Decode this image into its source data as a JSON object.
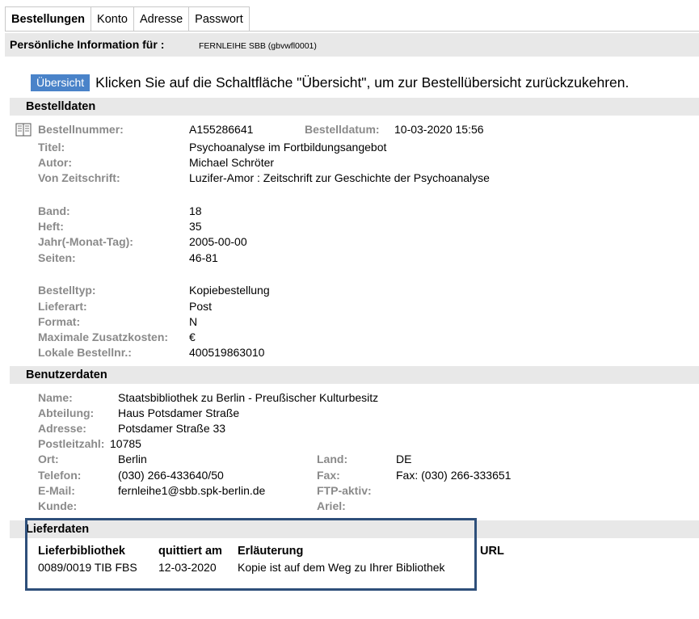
{
  "tabs": [
    "Bestellungen",
    "Konto",
    "Adresse",
    "Passwort"
  ],
  "info": {
    "label": "Persönliche Information für :",
    "value": "FERNLEIHE SBB (gbvwfl0001)"
  },
  "overview": {
    "button": "Übersicht",
    "text": "Klicken Sie auf die Schaltfläche \"Übersicht\", um zur Bestellübersicht zurückzukehren."
  },
  "bestelldaten": {
    "title": "Bestelldaten",
    "bestellnummer_label": "Bestellnummer:",
    "bestellnummer": "A155286641",
    "bestelldatum_label": "Bestelldatum:",
    "bestelldatum": "10-03-2020 15:56",
    "titel_label": "Titel:",
    "titel": "Psychoanalyse im Fortbildungsangebot",
    "autor_label": "Autor:",
    "autor": "Michael Schröter",
    "zeitschrift_label": "Von Zeitschrift:",
    "zeitschrift": "Luzifer-Amor : Zeitschrift zur Geschichte der Psychoanalyse",
    "band_label": "Band:",
    "band": "18",
    "heft_label": "Heft:",
    "heft": "35",
    "jahr_label": "Jahr(-Monat-Tag):",
    "jahr": "2005-00-00",
    "seiten_label": "Seiten:",
    "seiten": "46-81",
    "bestelltyp_label": "Bestelltyp:",
    "bestelltyp": "Kopiebestellung",
    "lieferart_label": "Lieferart:",
    "lieferart": "Post",
    "format_label": "Format:",
    "format": "N",
    "kosten_label": "Maximale Zusatzkosten:",
    "kosten": "€",
    "lokale_label": "Lokale Bestellnr.:",
    "lokale": "400519863010"
  },
  "benutzerdaten": {
    "title": "Benutzerdaten",
    "name_label": "Name:",
    "name": "Staatsbibliothek zu Berlin - Preußischer Kulturbesitz",
    "abteilung_label": "Abteilung:",
    "abteilung": "Haus Potsdamer Straße",
    "adresse_label": "Adresse:",
    "adresse": "Potsdamer Straße 33",
    "plz_label": "Postleitzahl:",
    "plz": "10785",
    "ort_label": "Ort:",
    "ort": "Berlin",
    "land_label": "Land:",
    "land": "DE",
    "telefon_label": "Telefon:",
    "telefon": "(030) 266-433640/50",
    "fax_label": "Fax:",
    "fax": "Fax: (030) 266-333651",
    "email_label": "E-Mail:",
    "email": "fernleihe1@sbb.spk-berlin.de",
    "ftp_label": "FTP-aktiv:",
    "kunde_label": "Kunde:",
    "ariel_label": "Ariel:"
  },
  "lieferdaten": {
    "title": "Lieferdaten",
    "headers": [
      "Lieferbibliothek",
      "quittiert am",
      "Erläuterung",
      "URL"
    ],
    "row": [
      "0089/0019 TIB FBS",
      "12-03-2020",
      "Kopie ist auf dem Weg zu Ihrer Bibliothek",
      ""
    ]
  }
}
